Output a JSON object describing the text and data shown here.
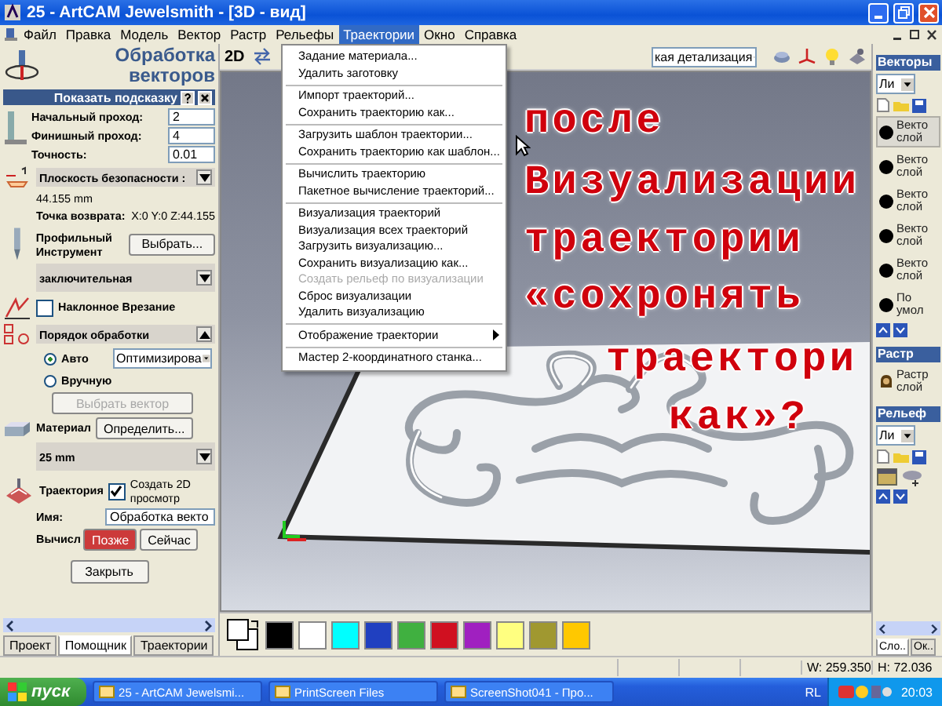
{
  "window": {
    "title": "25 - ArtCAM Jewelsmith - [3D - вид]"
  },
  "menu_bar": [
    {
      "label": "Файл",
      "selected": false
    },
    {
      "label": "Правка",
      "selected": false
    },
    {
      "label": "Модель",
      "selected": false
    },
    {
      "label": "Вектор",
      "selected": false
    },
    {
      "label": "Растр",
      "selected": false
    },
    {
      "label": "Рельефы",
      "selected": false
    },
    {
      "label": "Траектории",
      "selected": true
    },
    {
      "label": "Окно",
      "selected": false
    },
    {
      "label": "Справка",
      "selected": false
    }
  ],
  "open_menu": {
    "groups": [
      [
        {
          "label": "Задание материала...",
          "disabled": false,
          "submenu": false
        },
        {
          "label": "Удалить заготовку",
          "disabled": false,
          "submenu": false
        }
      ],
      [
        {
          "label": "Импорт траекторий...",
          "disabled": false,
          "submenu": false
        },
        {
          "label": "Сохранить траекторию как...",
          "disabled": false,
          "submenu": false
        }
      ],
      [
        {
          "label": "Загрузить шаблон траектории...",
          "disabled": false,
          "submenu": false
        },
        {
          "label": "Сохранить траекторию как шаблон...",
          "disabled": false,
          "submenu": false
        }
      ],
      [
        {
          "label": "Вычислить траекторию",
          "disabled": false,
          "submenu": false
        },
        {
          "label": "Пакетное вычисление траекторий...",
          "disabled": false,
          "submenu": false
        }
      ],
      [
        {
          "label": "Визуализация траекторий",
          "disabled": false,
          "submenu": false
        },
        {
          "label": "Визуализация всех траекторий",
          "disabled": false,
          "submenu": false
        },
        {
          "label": "Загрузить визуализацию...",
          "disabled": false,
          "submenu": false
        },
        {
          "label": "Сохранить визуализацию как...",
          "disabled": false,
          "submenu": false
        },
        {
          "label": "Создать рельеф по визуализации",
          "disabled": true,
          "submenu": false
        },
        {
          "label": "Сброс визуализации",
          "disabled": false,
          "submenu": false
        },
        {
          "label": "Удалить визуализацию",
          "disabled": false,
          "submenu": false
        }
      ],
      [
        {
          "label": "Отображение траектории",
          "disabled": false,
          "submenu": true
        }
      ],
      [
        {
          "label": "Мастер 2-координатного станка...",
          "disabled": false,
          "submenu": false
        }
      ]
    ]
  },
  "assistant": {
    "title": "Обработка векторов",
    "hint_bar": "Показать подсказку",
    "fields": [
      {
        "label": "Начальный проход:",
        "value": "2"
      },
      {
        "label": "Финишный проход:",
        "value": "4"
      },
      {
        "label": "Точность:",
        "value": "0.01"
      }
    ],
    "safety": {
      "header": "Плоскость безопасности :",
      "expanded": false,
      "value": "44.155 mm",
      "return_label": "Точка возврата:",
      "return_value": "X:0 Y:0 Z:44.155"
    },
    "tool": {
      "label": "Профильный Инструмент",
      "button": "Выбрать...",
      "header": "заключительная",
      "expanded": false
    },
    "ramp": {
      "label": "Наклонное Врезание",
      "checked": false
    },
    "order": {
      "header": "Порядок обработки",
      "expanded": true,
      "options": [
        {
          "label": "Авто",
          "selected": true
        },
        {
          "label": "Вручную",
          "selected": false
        }
      ],
      "mode": "Оптимизирова",
      "button": "Выбрать вектор",
      "button_disabled": true
    },
    "material": {
      "label": "Материал",
      "button": "Определить...",
      "header": "25 mm",
      "expanded": false
    },
    "toolpath": {
      "label": "Траектория",
      "preview": {
        "label": "Создать 2D просмотр",
        "checked": true
      },
      "name_label": "Имя:",
      "name_value": "Обработка векто",
      "calc_label": "Вычисл",
      "calc_buttons": [
        {
          "label": "Позже",
          "selected": true
        },
        {
          "label": "Сейчас",
          "selected": false
        }
      ]
    },
    "close_button": "Закрыть",
    "tabs": [
      {
        "label": "Проект",
        "selected": false
      },
      {
        "label": "Помощник",
        "selected": true
      },
      {
        "label": "Траектории",
        "selected": false
      }
    ]
  },
  "viewport": {
    "toolbar": {
      "mode": "2D",
      "detail": "кая детализация"
    },
    "annotation": [
      "после",
      "Визуализации",
      "траектории",
      "«сохронять",
      "траектори",
      "как»?"
    ],
    "palette": [
      {
        "color": "#000000"
      },
      {
        "color": "#ffffff"
      },
      {
        "color": "#00ffff"
      },
      {
        "color": "#2040c0"
      },
      {
        "color": "#40b040"
      },
      {
        "color": "#d01020"
      },
      {
        "color": "#a020c0"
      },
      {
        "color": "#ffff80"
      },
      {
        "color": "#a09830"
      },
      {
        "color": "#ffc800"
      }
    ]
  },
  "right_panel": {
    "vectors": {
      "header": "Векторы",
      "filter": "Ли",
      "layers": [
        {
          "name": "Векто",
          "sub": "слой",
          "selected": true
        },
        {
          "name": "Векто",
          "sub": "слой",
          "selected": false
        },
        {
          "name": "Векто",
          "sub": "слой",
          "selected": false
        },
        {
          "name": "Векто",
          "sub": "слой",
          "selected": false
        },
        {
          "name": "Векто",
          "sub": "слой",
          "selected": false
        },
        {
          "name": "По",
          "sub": "умол",
          "selected": false
        }
      ]
    },
    "raster": {
      "header": "Растр",
      "layer": {
        "name": "Растр",
        "sub": "слой"
      }
    },
    "relief": {
      "header": "Рельеф",
      "filter": "Ли"
    },
    "tabs": [
      {
        "label": "Сло..",
        "selected": true
      },
      {
        "label": "Ок..",
        "selected": false
      }
    ]
  },
  "status_bar": {
    "width": "W: 259.350",
    "height": "H: 72.036"
  },
  "taskbar": {
    "start": "пуск",
    "tasks": [
      {
        "label": "25 - ArtCAM Jewelsmi..."
      },
      {
        "label": "PrintScreen Files"
      },
      {
        "label": "ScreenShot041 - Про..."
      }
    ],
    "language": "RL",
    "clock": "20:03"
  }
}
